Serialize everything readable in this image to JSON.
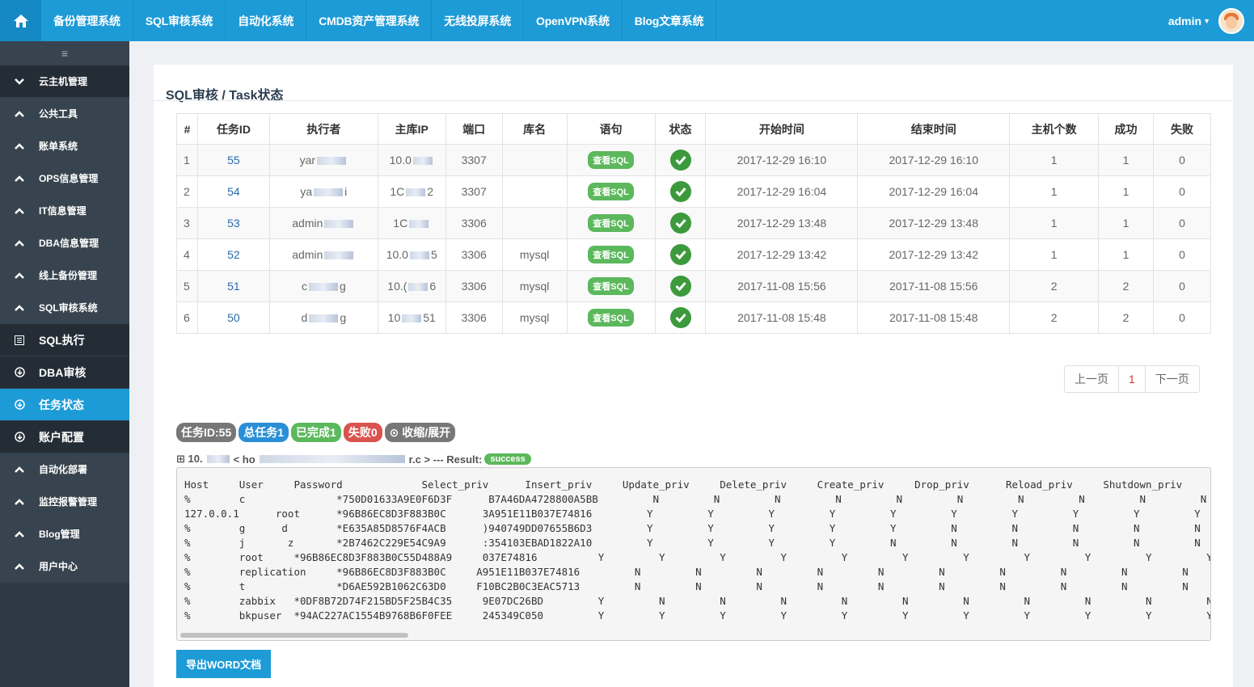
{
  "topnav": {
    "items": [
      "备份管理系统",
      "SQL审核系统",
      "自动化系统",
      "CMDB资产管理系统",
      "无线投屏系统",
      "OpenVPN系统",
      "Blog文章系统"
    ],
    "user": "admin"
  },
  "sidebar": {
    "toggle": "≡",
    "items": [
      {
        "label": "云主机管理",
        "icon": "chevron-down-icon"
      },
      {
        "label": "公共工具",
        "icon": "chevron-up-icon"
      },
      {
        "label": "账单系统",
        "icon": "chevron-up-icon"
      },
      {
        "label": "OPS信息管理",
        "icon": "chevron-up-icon"
      },
      {
        "label": "IT信息管理",
        "icon": "chevron-up-icon"
      },
      {
        "label": "DBA信息管理",
        "icon": "chevron-up-icon"
      },
      {
        "label": "线上备份管理",
        "icon": "chevron-up-icon"
      },
      {
        "label": "SQL审核系统",
        "icon": "chevron-up-icon"
      },
      {
        "label": "SQL执行",
        "icon": "list-icon"
      },
      {
        "label": "DBA审核",
        "icon": "circle-down-icon"
      },
      {
        "label": "任务状态",
        "icon": "circle-down-icon"
      },
      {
        "label": "账户配置",
        "icon": "circle-down-icon"
      },
      {
        "label": "自动化部署",
        "icon": "chevron-up-icon"
      },
      {
        "label": "监控报警管理",
        "icon": "chevron-up-icon"
      },
      {
        "label": "Blog管理",
        "icon": "chevron-up-icon"
      },
      {
        "label": "用户中心",
        "icon": "chevron-up-icon"
      }
    ]
  },
  "panel": {
    "title": "SQL审核 / Task状态",
    "columns": [
      "#",
      "任务ID",
      "执行者",
      "主库IP",
      "端口",
      "库名",
      "语句",
      "状态",
      "开始时间",
      "结束时间",
      "主机个数",
      "成功",
      "失败"
    ],
    "rows": [
      {
        "idx": "1",
        "tid": "55",
        "user_a": "yar",
        "user_b": "",
        "ip_a": "10.0",
        "ip_b": "",
        "port": "3307",
        "db": "",
        "sql": "查看SQL",
        "start": "2017-12-29 16:10",
        "end": "2017-12-29 16:10",
        "hosts": "1",
        "ok": "1",
        "fail": "0"
      },
      {
        "idx": "2",
        "tid": "54",
        "user_a": "ya",
        "user_b": "i",
        "ip_a": "1C",
        "ip_b": "2",
        "port": "3307",
        "db": "",
        "sql": "查看SQL",
        "start": "2017-12-29 16:04",
        "end": "2017-12-29 16:04",
        "hosts": "1",
        "ok": "1",
        "fail": "0"
      },
      {
        "idx": "3",
        "tid": "53",
        "user_a": "admin",
        "user_b": "",
        "ip_a": "1C",
        "ip_b": "",
        "port": "3306",
        "db": "",
        "sql": "查看SQL",
        "start": "2017-12-29 13:48",
        "end": "2017-12-29 13:48",
        "hosts": "1",
        "ok": "1",
        "fail": "0"
      },
      {
        "idx": "4",
        "tid": "52",
        "user_a": "admin",
        "user_b": "",
        "ip_a": "10.0",
        "ip_b": "5",
        "port": "3306",
        "db": "mysql",
        "sql": "查看SQL",
        "start": "2017-12-29 13:42",
        "end": "2017-12-29 13:42",
        "hosts": "1",
        "ok": "1",
        "fail": "0"
      },
      {
        "idx": "5",
        "tid": "51",
        "user_a": "c",
        "user_b": "g",
        "ip_a": "10.(",
        "ip_b": "6",
        "port": "3306",
        "db": "mysql",
        "sql": "查看SQL",
        "start": "2017-11-08 15:56",
        "end": "2017-11-08 15:56",
        "hosts": "2",
        "ok": "2",
        "fail": "0"
      },
      {
        "idx": "6",
        "tid": "50",
        "user_a": "d",
        "user_b": "g",
        "ip_a": "10",
        "ip_b": "51",
        "port": "3306",
        "db": "mysql",
        "sql": "查看SQL",
        "start": "2017-11-08 15:48",
        "end": "2017-11-08 15:48",
        "hosts": "2",
        "ok": "2",
        "fail": "0"
      }
    ],
    "pager": {
      "prev": "上一页",
      "current": "1",
      "next": "下一页"
    },
    "tags": {
      "task": "任务ID:55",
      "total": "总任务1",
      "done": "已完成1",
      "failed": "失败0",
      "toggle": "收缩/展开"
    },
    "result_line": {
      "prefix": "⊞ 10.",
      "host": "< ho",
      "mid": "r.c > --- Result:",
      "status": "success"
    },
    "result_text": "Host     User     Password             Select_priv      Insert_priv     Update_priv     Delete_priv     Create_priv     Drop_priv      Reload_priv     Shutdown_priv     Pr\n%        c               *750D01633A9E0F6D3F      B7A46DA4728800A5BB         N         N         N         N         N         N         N         N         N         N         N\n127.0.0.1      root      *96B86EC8D3F883B0C      3A951E11B037E74816         Y         Y         Y         Y         Y         Y         Y         Y         Y         Y         Y\n%        g      d        *E635A85D8576F4ACB      )940749DD07655B6D3         Y         Y         Y         Y         Y         N         N         N         N         N         N\n%        j       z       *2B7462C229E54C9A9      :354103EBAD1822A10         Y         Y         Y         Y         N         N         N         N         N         N         N\n%        root     *96B86EC8D3F883B0C55D488A9     037E74816          Y         Y         Y         Y         Y         Y         Y         Y         Y         Y         Y\n%        replication     *96B86EC8D3F883B0C     A951E11B037E74816         N         N         N         N         N         N         N         N         N         N         N\n%        t               *D6AE592B1062C63D0     F10BC2B0C3EAC5713         N         N         N         N         N         N         N         N         N         N         N\n%        zabbix   *0DF8B72D74F215BD5F25B4C35     9E07DC26BD         Y         N         N         N         N         N         N         N         N         N         N\n%        bkpuser  *94AC227AC1554B9768B6F0FEE     245349C050         Y         Y         Y         Y         Y         Y         Y         Y         Y         Y         Y",
    "export": "导出WORD文档"
  }
}
